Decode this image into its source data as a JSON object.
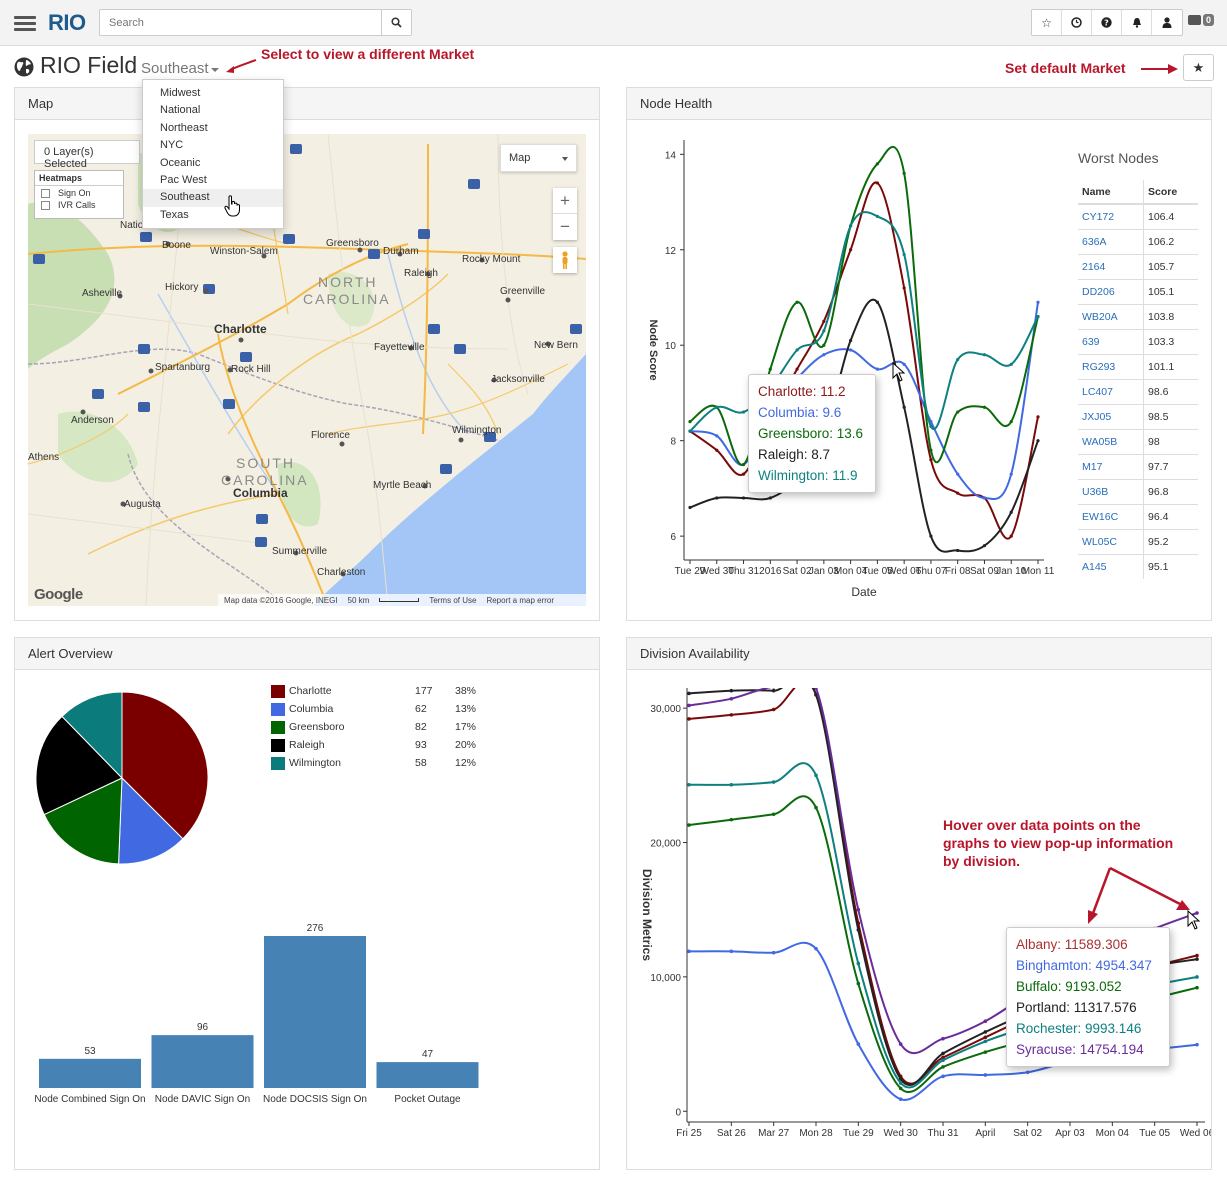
{
  "navbar": {
    "logo": "RIO",
    "search_placeholder": "Search",
    "icons": [
      "star-icon",
      "clock-icon",
      "help-icon",
      "bell-icon",
      "user-icon"
    ],
    "chat_count": "0"
  },
  "title_row": {
    "title": "RIO Field",
    "market_selected": "Southeast",
    "annotation_select": "Select to view a different Market",
    "annotation_default": "Set default Market"
  },
  "market_menu": {
    "items": [
      "Midwest",
      "National",
      "Northeast",
      "NYC",
      "Oceanic",
      "Pac West",
      "Southeast",
      "Texas"
    ],
    "active": "Southeast"
  },
  "map_panel": {
    "header": "Map",
    "layer_dropdown": "0 Layer(s) Selected",
    "heatmaps_title": "Heatmaps",
    "heatmaps": [
      "Sign On",
      "IVR Calls"
    ],
    "map_type": "Map",
    "labels": {
      "nc": "NORTH CAROLINA",
      "sc": "SOUTH CAROLINA",
      "cities": [
        "Charlotte",
        "Greensboro",
        "Durham",
        "Raleigh",
        "Winston-Salem",
        "Asheville",
        "Hickory",
        "Fayetteville",
        "Greenville",
        "Spartanburg",
        "Rock Hill",
        "Anderson",
        "Florence",
        "Columbia",
        "Augusta",
        "Wilmington",
        "Myrtle Beach",
        "Charleston",
        "Summerville",
        "Jacksonville",
        "Rocky Mount",
        "New Bern",
        "Boone",
        "Athens",
        "Nation"
      ]
    },
    "footer": [
      "Map data ©2016 Google, INEGI",
      "50 km",
      "Terms of Use",
      "Report a map error"
    ],
    "google": "Google"
  },
  "node_health": {
    "header": "Node Health",
    "worst_nodes_title": "Worst Nodes",
    "table_headers": [
      "Name",
      "Score"
    ],
    "worst_nodes": [
      [
        "CY172",
        "106.4"
      ],
      [
        "636A",
        "106.2"
      ],
      [
        "2164",
        "105.7"
      ],
      [
        "DD206",
        "105.1"
      ],
      [
        "WB20A",
        "103.8"
      ],
      [
        "639",
        "103.3"
      ],
      [
        "RG293",
        "101.1"
      ],
      [
        "LC407",
        "98.6"
      ],
      [
        "JXJ05",
        "98.5"
      ],
      [
        "WA05B",
        "98"
      ],
      [
        "M17",
        "97.7"
      ],
      [
        "U36B",
        "96.8"
      ],
      [
        "EW16C",
        "96.4"
      ],
      [
        "WL05C",
        "95.2"
      ],
      [
        "A145",
        "95.1"
      ]
    ],
    "tooltip": [
      {
        "label": "Charlotte: 11.2",
        "color": "#7a0a0a"
      },
      {
        "label": "Columbia: 9.6",
        "color": "#4169e1"
      },
      {
        "label": "Greensboro: 13.6",
        "color": "#0b6b0b"
      },
      {
        "label": "Raleigh: 8.7",
        "color": "#222222"
      },
      {
        "label": "Wilmington: 11.9",
        "color": "#0e8080"
      }
    ]
  },
  "alert_overview": {
    "header": "Alert Overview",
    "legend": [
      {
        "name": "Charlotte",
        "count": "177",
        "pct": "38%",
        "color": "#7a0000"
      },
      {
        "name": "Columbia",
        "count": "62",
        "pct": "13%",
        "color": "#4169e1"
      },
      {
        "name": "Greensboro",
        "count": "82",
        "pct": "17%",
        "color": "#006400"
      },
      {
        "name": "Raleigh",
        "count": "93",
        "pct": "20%",
        "color": "#000000"
      },
      {
        "name": "Wilmington",
        "count": "58",
        "pct": "12%",
        "color": "#0b7b7b"
      }
    ]
  },
  "division_availability": {
    "header": "Division Availability",
    "annotation": "Hover over data points on the graphs to view pop-up information by division.",
    "tooltip": [
      {
        "label": "Albany: 11589.306",
        "color": "#a83232"
      },
      {
        "label": "Binghamton: 4954.347",
        "color": "#4169e1"
      },
      {
        "label": "Buffalo: 9193.052",
        "color": "#0b6b0b"
      },
      {
        "label": "Portland: 11317.576",
        "color": "#222222"
      },
      {
        "label": "Rochester: 9993.146",
        "color": "#0e8080"
      },
      {
        "label": "Syracuse: 14754.194",
        "color": "#6a2c9a"
      }
    ]
  },
  "chart_data": [
    {
      "type": "line",
      "title": "",
      "xlabel": "Date",
      "ylabel": "Node Score",
      "x": [
        "Tue 29",
        "Wed 30",
        "Thu 31",
        "2016",
        "Sat 02",
        "Jan 03",
        "Mon 04",
        "Tue 05",
        "Wed 06",
        "Thu 07",
        "Fri 08",
        "Sat 09",
        "Jan 10",
        "Mon 11"
      ],
      "ylim": [
        5.5,
        14.3
      ],
      "yticks": [
        6,
        8,
        10,
        12,
        14
      ],
      "series": [
        {
          "name": "Charlotte",
          "color": "#7a0a0a",
          "values": [
            8.2,
            7.8,
            7.3,
            8.5,
            9.5,
            10.5,
            12.0,
            13.4,
            11.2,
            7.6,
            6.9,
            6.8,
            6.0,
            8.5
          ]
        },
        {
          "name": "Columbia",
          "color": "#4169e1",
          "values": [
            8.2,
            8.1,
            7.5,
            8.6,
            9.3,
            9.8,
            9.9,
            9.5,
            9.6,
            8.4,
            7.3,
            6.8,
            7.3,
            10.9
          ]
        },
        {
          "name": "Greensboro",
          "color": "#0b6b0b",
          "values": [
            8.4,
            8.7,
            7.5,
            9.5,
            10.9,
            10.0,
            12.5,
            13.8,
            13.6,
            7.8,
            8.6,
            8.7,
            8.4,
            10.6
          ]
        },
        {
          "name": "Raleigh",
          "color": "#222222",
          "values": [
            6.6,
            6.8,
            6.8,
            6.8,
            7.2,
            8.1,
            10.1,
            10.9,
            8.7,
            6.0,
            5.7,
            5.8,
            6.5,
            8.0
          ]
        },
        {
          "name": "Wilmington",
          "color": "#0e8080",
          "values": [
            8.2,
            8.7,
            8.6,
            9.1,
            9.9,
            10.3,
            12.5,
            12.7,
            11.9,
            8.3,
            9.7,
            9.8,
            9.6,
            10.6
          ]
        }
      ]
    },
    {
      "type": "pie",
      "title": "",
      "categories": [
        "Charlotte",
        "Columbia",
        "Greensboro",
        "Raleigh",
        "Wilmington"
      ],
      "values": [
        177,
        62,
        82,
        93,
        58
      ],
      "colors": [
        "#7a0000",
        "#4169e1",
        "#006400",
        "#000000",
        "#0b7b7b"
      ]
    },
    {
      "type": "bar",
      "title": "",
      "categories": [
        "Node Combined Sign On",
        "Node DAVIC Sign On",
        "Node DOCSIS Sign On",
        "Pocket Outage"
      ],
      "values": [
        53,
        96,
        276,
        47
      ],
      "color": "#4682b4",
      "ylim": [
        0,
        276
      ]
    },
    {
      "type": "line",
      "title": "",
      "xlabel": "",
      "ylabel": "Division Metrics",
      "x": [
        "Fri 25",
        "Sat 26",
        "Mar 27",
        "Mon 28",
        "Tue 29",
        "Wed 30",
        "Thu 31",
        "April",
        "Sat 02",
        "Apr 03",
        "Mon 04",
        "Tue 05",
        "Wed 06"
      ],
      "ylim": [
        -800,
        31500
      ],
      "yticks": [
        0,
        10000,
        20000,
        30000
      ],
      "series": [
        {
          "name": "Albany",
          "color": "#7a0a0a",
          "values": [
            29200,
            29500,
            29900,
            31000,
            14000,
            2600,
            4000,
            5500,
            7000,
            8500,
            9800,
            10800,
            11589.306
          ]
        },
        {
          "name": "Binghamton",
          "color": "#4169e1",
          "values": [
            11900,
            11900,
            11800,
            12100,
            5000,
            900,
            2600,
            2700,
            2900,
            3700,
            4200,
            4600,
            4954.347
          ]
        },
        {
          "name": "Buffalo",
          "color": "#0b6b0b",
          "values": [
            21300,
            21700,
            22100,
            22600,
            9500,
            1700,
            3300,
            4400,
            5300,
            6300,
            7400,
            8400,
            9193.052
          ]
        },
        {
          "name": "Portland",
          "color": "#222222",
          "values": [
            31100,
            31300,
            31300,
            31000,
            13500,
            2400,
            4300,
            5900,
            7300,
            8500,
            9800,
            10800,
            11317.576
          ]
        },
        {
          "name": "Rochester",
          "color": "#0e8080",
          "values": [
            24300,
            24300,
            24500,
            25000,
            11000,
            2100,
            3800,
            5200,
            6300,
            7500,
            8600,
            9400,
            9993.146
          ]
        },
        {
          "name": "Syracuse",
          "color": "#6a2c9a",
          "values": [
            30200,
            30700,
            31600,
            31500,
            15000,
            5000,
            5400,
            6700,
            8700,
            10500,
            12200,
            13600,
            14754.194
          ]
        }
      ]
    }
  ]
}
